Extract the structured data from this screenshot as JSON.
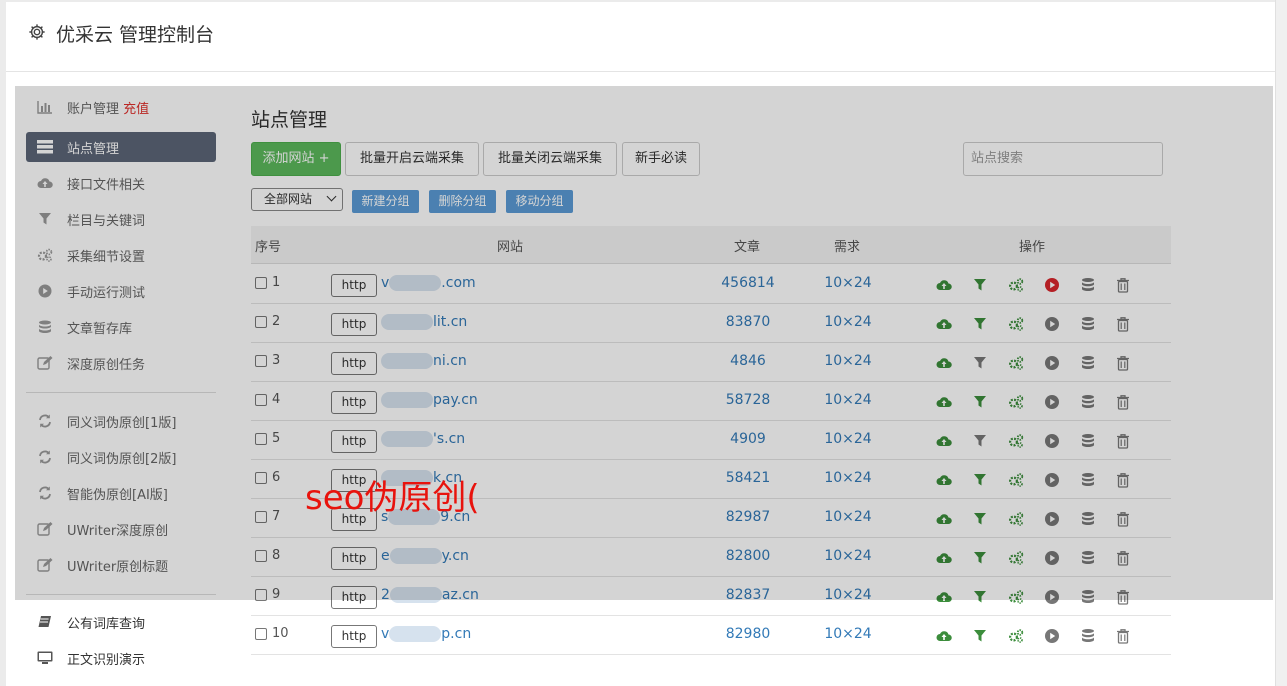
{
  "header": {
    "title": "优采云 管理控制台",
    "icon": "gear-icon"
  },
  "sidebar": {
    "items": [
      {
        "label": "账户管理",
        "badge": "充值",
        "icon": "bar-chart-icon"
      },
      {
        "label": "站点管理",
        "icon": "server-list-icon",
        "active": true
      },
      {
        "label": "接口文件相关",
        "icon": "cloud-upload-icon"
      },
      {
        "label": "栏目与关键词",
        "icon": "filter-icon"
      },
      {
        "label": "采集细节设置",
        "icon": "cogs-icon"
      },
      {
        "label": "手动运行测试",
        "icon": "play-circle-icon"
      },
      {
        "label": "文章暂存库",
        "icon": "database-icon"
      },
      {
        "label": "深度原创任务",
        "icon": "edit-icon"
      }
    ],
    "items2": [
      {
        "label": "同义词伪原创[1版]",
        "icon": "refresh-icon"
      },
      {
        "label": "同义词伪原创[2版]",
        "icon": "refresh-icon"
      },
      {
        "label": "智能伪原创[AI版]",
        "icon": "refresh-icon"
      },
      {
        "label": "UWriter深度原创",
        "icon": "edit-icon"
      },
      {
        "label": "UWriter原创标题",
        "icon": "edit-icon"
      }
    ],
    "items3": [
      {
        "label": "公有词库查询",
        "icon": "book-icon"
      },
      {
        "label": "正文识别演示",
        "icon": "monitor-icon"
      }
    ]
  },
  "main": {
    "title": "站点管理",
    "add_button": "添加网站 +",
    "batch_open": "批量开启云端采集",
    "batch_close": "批量关闭云端采集",
    "newbie": "新手必读",
    "search_placeholder": "站点搜索",
    "group_select": "全部网站",
    "new_group": "新建分组",
    "delete_group": "删除分组",
    "move_group": "移动分组"
  },
  "table": {
    "headers": {
      "no": "序号",
      "site": "网站",
      "articles": "文章",
      "demand": "需求",
      "ops": "操作"
    },
    "rows": [
      {
        "no": "1",
        "proto": "http",
        "pre": "v",
        "suf": ".com",
        "articles": "456814",
        "demand": "10×24",
        "filter_on": true,
        "play_red": true
      },
      {
        "no": "2",
        "proto": "http",
        "pre": "",
        "suf": "lit.cn",
        "articles": "83870",
        "demand": "10×24",
        "filter_on": true,
        "play_red": false
      },
      {
        "no": "3",
        "proto": "http",
        "pre": "",
        "suf": "ni.cn",
        "articles": "4846",
        "demand": "10×24",
        "filter_on": false,
        "play_red": false
      },
      {
        "no": "4",
        "proto": "http",
        "pre": "",
        "suf": "pay.cn",
        "articles": "58728",
        "demand": "10×24",
        "filter_on": true,
        "play_red": false
      },
      {
        "no": "5",
        "proto": "http",
        "pre": "",
        "suf": "'s.cn",
        "articles": "4909",
        "demand": "10×24",
        "filter_on": false,
        "play_red": false
      },
      {
        "no": "6",
        "proto": "http",
        "pre": "",
        "suf": "k.cn",
        "articles": "58421",
        "demand": "10×24",
        "filter_on": true,
        "play_red": false
      },
      {
        "no": "7",
        "proto": "http",
        "pre": "s",
        "suf": "9.cn",
        "articles": "82987",
        "demand": "10×24",
        "filter_on": true,
        "play_red": false
      },
      {
        "no": "8",
        "proto": "http",
        "pre": "e",
        "suf": "y.cn",
        "articles": "82800",
        "demand": "10×24",
        "filter_on": true,
        "play_red": false
      },
      {
        "no": "9",
        "proto": "http",
        "pre": "2",
        "suf": "az.cn",
        "articles": "82837",
        "demand": "10×24",
        "filter_on": true,
        "play_red": false
      },
      {
        "no": "10",
        "proto": "http",
        "pre": "v",
        "suf": "p.cn",
        "articles": "82980",
        "demand": "10×24",
        "filter_on": true,
        "play_red": false
      }
    ]
  },
  "watermark": "seo伪原创(",
  "colors": {
    "green": "#3c8d3c",
    "grey": "#777777",
    "play_red": "#d9262c",
    "link": "#337ab7",
    "active_nav": "#5c6678",
    "badge": "#e0302c"
  }
}
